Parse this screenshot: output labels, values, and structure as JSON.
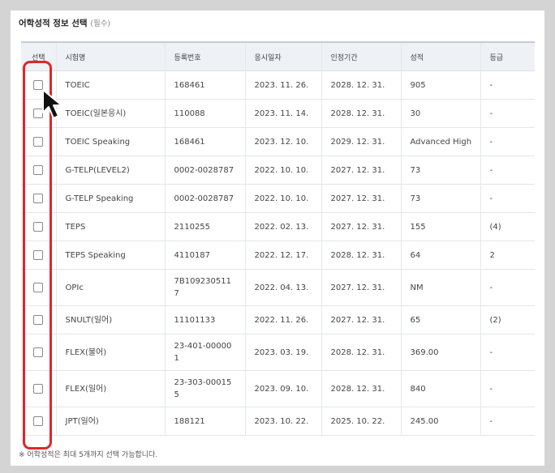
{
  "section": {
    "title": "어학성적 정보 선택",
    "required": "(필수)"
  },
  "table": {
    "headers": {
      "select": "선택",
      "exam": "시험명",
      "reg_no": "등록번호",
      "test_date": "응시일자",
      "valid_until": "인정기간",
      "score": "성적",
      "grade": "등급"
    },
    "rows": [
      {
        "exam": "TOEIC",
        "reg_no": "168461",
        "test_date": "2023. 11. 26.",
        "valid_until": "2028. 12. 31.",
        "score": "905",
        "grade": "-"
      },
      {
        "exam": "TOEIC(일본응시)",
        "reg_no": "110088",
        "test_date": "2023. 11. 14.",
        "valid_until": "2028. 12. 31.",
        "score": "30",
        "grade": "-"
      },
      {
        "exam": "TOEIC Speaking",
        "reg_no": "168461",
        "test_date": "2023. 12. 10.",
        "valid_until": "2029. 12. 31.",
        "score": "Advanced High",
        "grade": "-"
      },
      {
        "exam": "G-TELP(LEVEL2)",
        "reg_no": "0002-0028787",
        "test_date": "2022. 10. 10.",
        "valid_until": "2027. 12. 31.",
        "score": "73",
        "grade": "-"
      },
      {
        "exam": "G-TELP Speaking",
        "reg_no": "0002-0028787",
        "test_date": "2022. 10. 10.",
        "valid_until": "2027. 12. 31.",
        "score": "73",
        "grade": "-"
      },
      {
        "exam": "TEPS",
        "reg_no": "2110255",
        "test_date": "2022. 02. 13.",
        "valid_until": "2027. 12. 31.",
        "score": "155",
        "grade": "(4)"
      },
      {
        "exam": "TEPS Speaking",
        "reg_no": "4110187",
        "test_date": "2022. 12. 17.",
        "valid_until": "2028. 12. 31.",
        "score": "64",
        "grade": "2"
      },
      {
        "exam": "OPIc",
        "reg_no": "7B109230511\n7",
        "test_date": "2022. 04. 13.",
        "valid_until": "2027. 12. 31.",
        "score": "NM",
        "grade": "-"
      },
      {
        "exam": "SNULT(일어)",
        "reg_no": "11101133",
        "test_date": "2022. 11. 26.",
        "valid_until": "2027. 12. 31.",
        "score": "65",
        "grade": "(2)"
      },
      {
        "exam": "FLEX(불어)",
        "reg_no": "23-401-00000\n1",
        "test_date": "2023. 03. 19.",
        "valid_until": "2028. 12. 31.",
        "score": "369.00",
        "grade": "-"
      },
      {
        "exam": "FLEX(일어)",
        "reg_no": "23-303-00015\n5",
        "test_date": "2023. 09. 10.",
        "valid_until": "2028. 12. 31.",
        "score": "840",
        "grade": "-"
      },
      {
        "exam": "JPT(일어)",
        "reg_no": "188121",
        "test_date": "2023. 10. 22.",
        "valid_until": "2025. 10. 22.",
        "score": "245.00",
        "grade": "-"
      }
    ]
  },
  "footnote": "※ 어학성적은 최대 5개까지 선택 가능합니다.",
  "colors": {
    "highlight": "#e0262b",
    "header_bg": "#eef1f5"
  },
  "icons": {
    "pointer": "mouse-pointer-icon",
    "checkbox": "checkbox-icon"
  }
}
